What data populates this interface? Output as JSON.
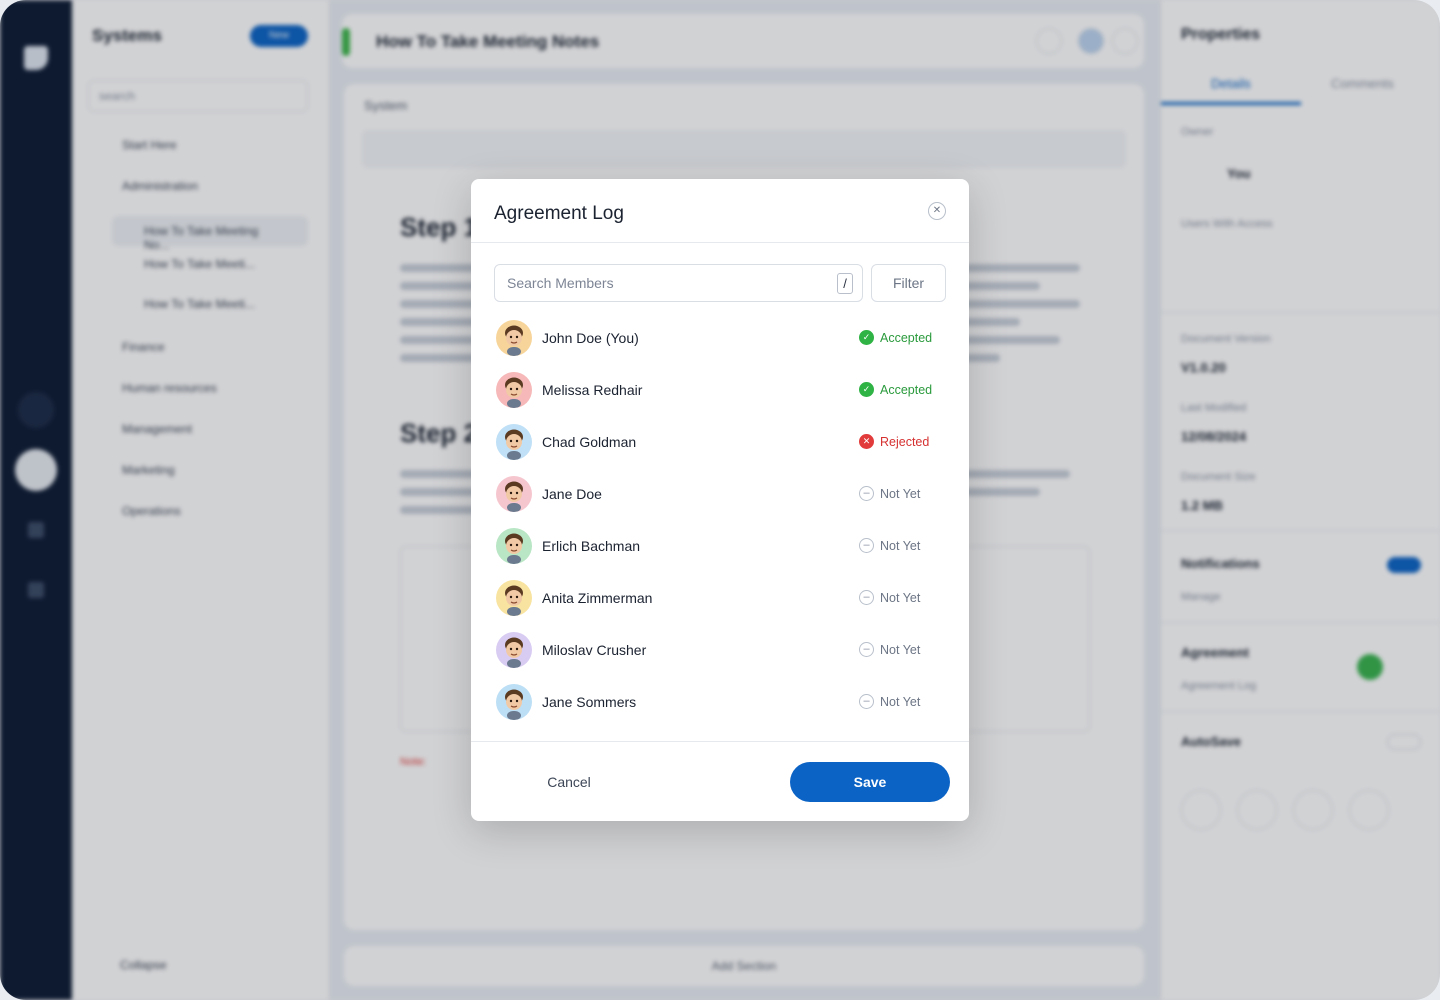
{
  "background": {
    "sidebar_title": "Systems",
    "new_button": "New",
    "search_placeholder": "search",
    "nav_items": [
      "Start Here",
      "Administration",
      "How To Take Meeting No...",
      "How To Take Meeti...",
      "How To Take Meeti...",
      "Finance",
      "Human resources",
      "Management",
      "Marketing",
      "Operations"
    ],
    "collapse": "Collapse",
    "doc_title": "How To Take Meeting Notes",
    "system_label": "System",
    "step1": "Step 1",
    "step2": "Step 2",
    "note_label": "Note:",
    "add_section": "Add Section",
    "props_title": "Properties",
    "tab_details": "Details",
    "tab_comments": "Comments",
    "owner_label": "Owner",
    "owner_value": "You",
    "users_label": "Users With Access",
    "version_label": "Document Version",
    "version_value": "V1.0.20",
    "modified_label": "Last Modified",
    "modified_value": "12/08/2024",
    "size_label": "Document Size",
    "size_value": "1.2 MB",
    "notifications": "Notifications",
    "notif_sub": "Manage",
    "agreement": "Agreement",
    "agreement_sub": "Agreement Log",
    "autosave": "AutoSave"
  },
  "modal": {
    "title": "Agreement Log",
    "search_placeholder": "Search Members",
    "search_value": "",
    "shortcut_key": "/",
    "filter_label": "Filter",
    "cancel_label": "Cancel",
    "save_label": "Save",
    "members": [
      {
        "name": "John Doe (You)",
        "status": "Accepted",
        "state": "accepted",
        "avatar_bg": "#f7d59a"
      },
      {
        "name": "Melissa Redhair",
        "status": "Accepted",
        "state": "accepted",
        "avatar_bg": "#f6b8b8"
      },
      {
        "name": "Chad Goldman",
        "status": "Rejected",
        "state": "rejected",
        "avatar_bg": "#bfe0f6"
      },
      {
        "name": "Jane Doe",
        "status": "Not Yet",
        "state": "pending",
        "avatar_bg": "#f6c6cf"
      },
      {
        "name": "Erlich Bachman",
        "status": "Not Yet",
        "state": "pending",
        "avatar_bg": "#b9e6c4"
      },
      {
        "name": "Anita Zimmerman",
        "status": "Not Yet",
        "state": "pending",
        "avatar_bg": "#f8e3a0"
      },
      {
        "name": "Miloslav Crusher",
        "status": "Not Yet",
        "state": "pending",
        "avatar_bg": "#d9ccf3"
      },
      {
        "name": "Jane Sommers",
        "status": "Not Yet",
        "state": "pending",
        "avatar_bg": "#bcdff5"
      }
    ]
  },
  "colors": {
    "accent": "#0b63c5",
    "accepted": "#2fb344",
    "rejected": "#e23b3b",
    "rail": "#0c1a33"
  }
}
